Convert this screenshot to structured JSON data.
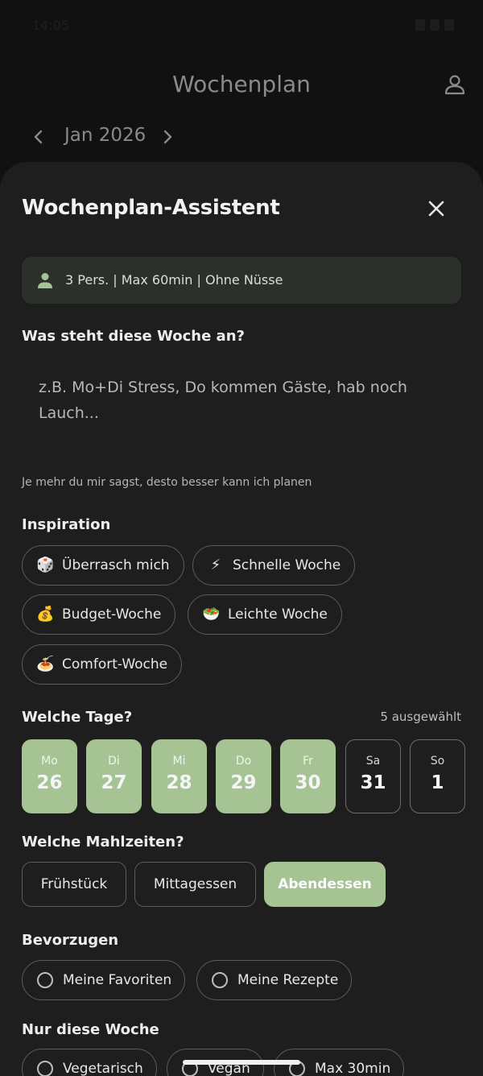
{
  "status": {
    "time": "14:05"
  },
  "header": {
    "title": "Wochenplan"
  },
  "month_nav": {
    "label": "Jan 2026"
  },
  "sheet": {
    "title": "Wochenplan-Assistent",
    "prefs_summary": "3 Pers. | Max 60min | Ohne Nüsse",
    "question": "Was steht diese Woche an?",
    "input_placeholder": "z.B. Mo+Di Stress, Do kommen Gäste, hab noch Lauch...",
    "hint": "Je mehr du mir sagst, desto besser kann ich planen",
    "inspiration": {
      "label": "Inspiration",
      "chips": [
        {
          "emoji": "🎲",
          "label": "Überrasch mich"
        },
        {
          "emoji": "⚡",
          "label": "Schnelle Woche"
        },
        {
          "emoji": "💰",
          "label": "Budget-Woche"
        },
        {
          "emoji": "🥗",
          "label": "Leichte Woche"
        },
        {
          "emoji": "🍝",
          "label": "Comfort-Woche"
        }
      ]
    },
    "days": {
      "label": "Welche Tage?",
      "selected_count": "5 ausgewählt",
      "items": [
        {
          "name": "Mo",
          "num": "26",
          "selected": true
        },
        {
          "name": "Di",
          "num": "27",
          "selected": true
        },
        {
          "name": "Mi",
          "num": "28",
          "selected": true
        },
        {
          "name": "Do",
          "num": "29",
          "selected": true
        },
        {
          "name": "Fr",
          "num": "30",
          "selected": true
        },
        {
          "name": "Sa",
          "num": "31",
          "selected": false
        },
        {
          "name": "So",
          "num": "1",
          "selected": false
        }
      ]
    },
    "meals": {
      "label": "Welche Mahlzeiten?",
      "items": [
        {
          "label": "Frühstück",
          "selected": false
        },
        {
          "label": "Mittagessen",
          "selected": false
        },
        {
          "label": "Abendessen",
          "selected": true
        }
      ]
    },
    "prefer": {
      "label": "Bevorzugen",
      "options": [
        {
          "label": "Meine Favoriten",
          "checked": false
        },
        {
          "label": "Meine Rezepte",
          "checked": false
        }
      ]
    },
    "this_week": {
      "label": "Nur diese Woche",
      "options": [
        {
          "label": "Vegetarisch",
          "checked": false
        },
        {
          "label": "Vegan",
          "checked": false
        },
        {
          "label": "Max 30min",
          "checked": false
        }
      ]
    }
  },
  "colors": {
    "background": "#111111",
    "sheet": "#1e1e1e",
    "accent": "#a6c394",
    "prefs_box": "#2c302b"
  }
}
